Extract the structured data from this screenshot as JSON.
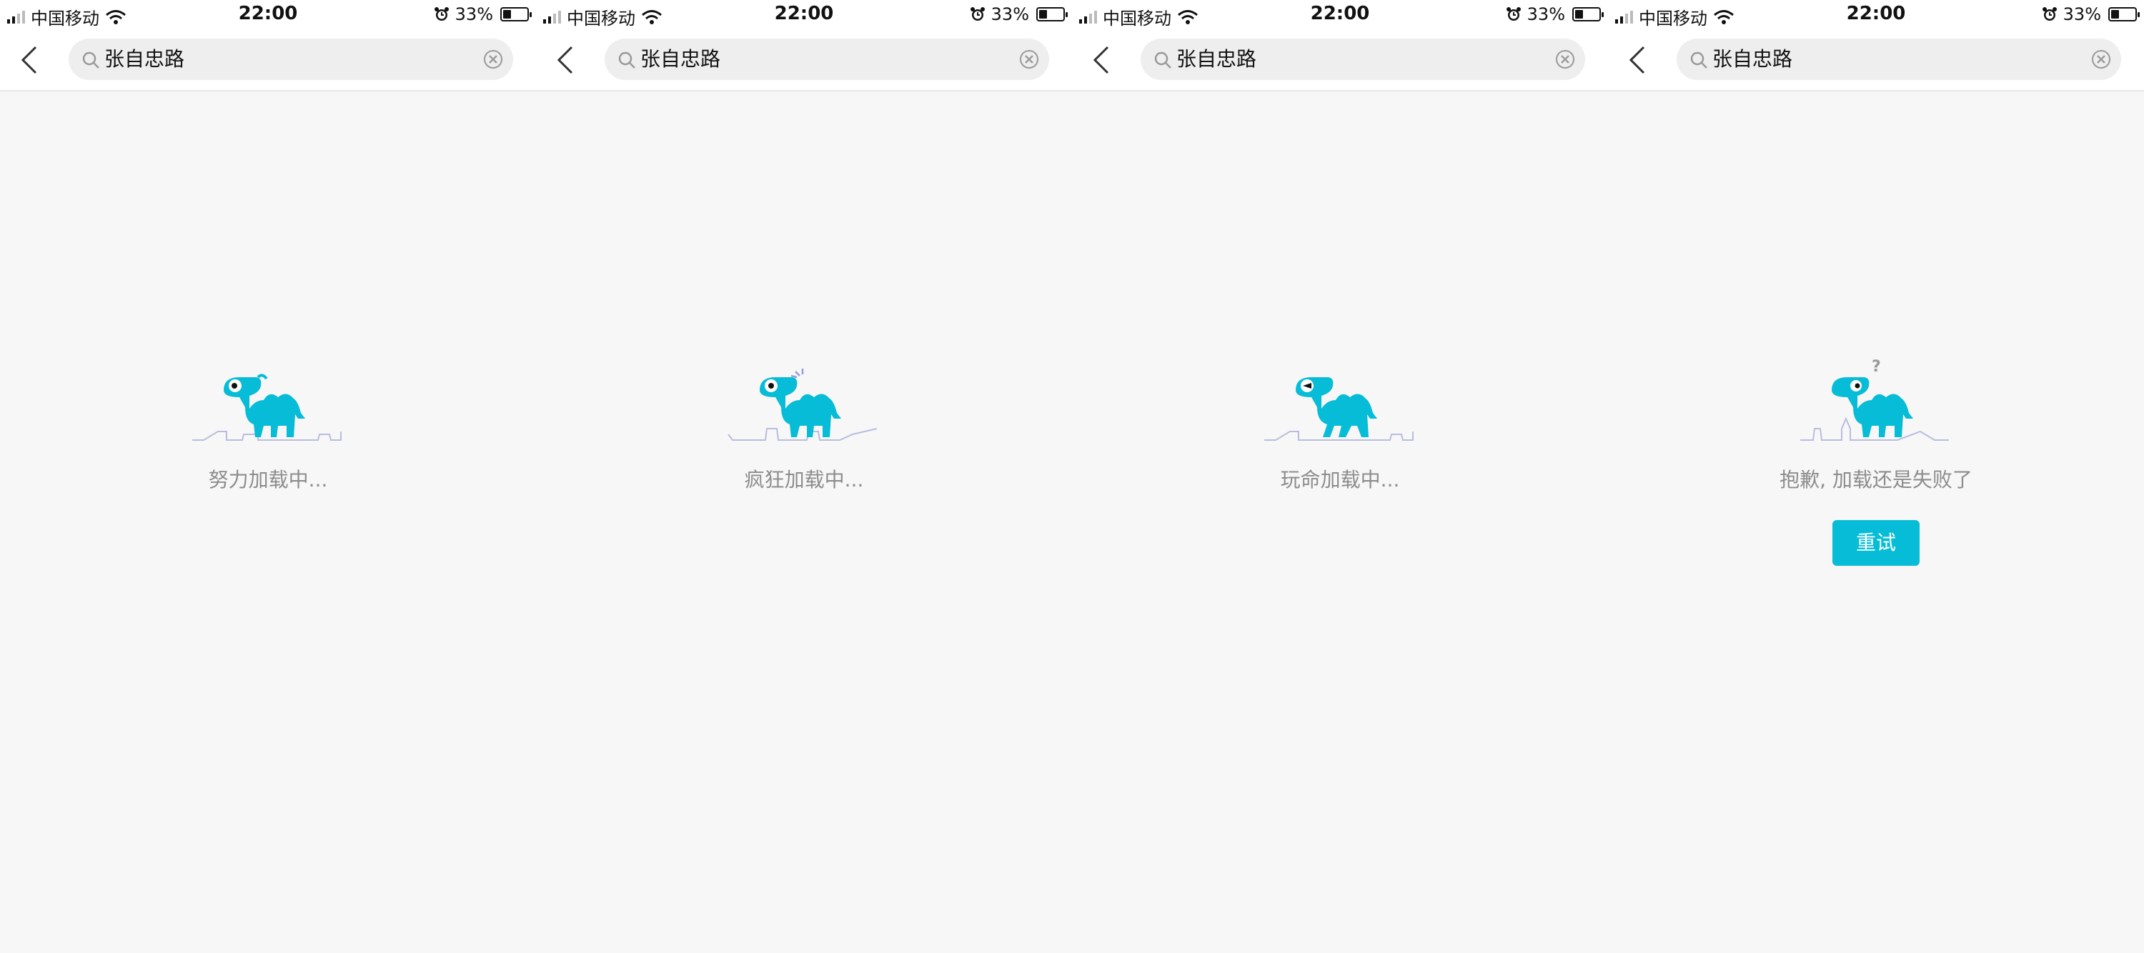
{
  "status_bar": {
    "carrier": "中国移动",
    "time": "22:00",
    "battery": "33%",
    "battery_level": 0.33
  },
  "search": {
    "query": "张自忠路"
  },
  "screens": [
    {
      "message": "努力加载中..."
    },
    {
      "message": "疯狂加载中..."
    },
    {
      "message": "玩命加载中..."
    },
    {
      "message": "抱歉, 加载还是失败了",
      "retry_label": "重试"
    }
  ],
  "colors": {
    "accent": "#07bcd7",
    "background": "#f7f7f7",
    "message_text": "#8c8c8c",
    "skyline": "#b8bde0"
  },
  "icons": {
    "back": "chevron-left-icon",
    "search": "search-icon",
    "clear": "clear-icon",
    "wifi": "wifi-icon",
    "alarm": "alarm-icon",
    "mascot": "camel-mascot-icon",
    "question": "question-mark-icon"
  }
}
